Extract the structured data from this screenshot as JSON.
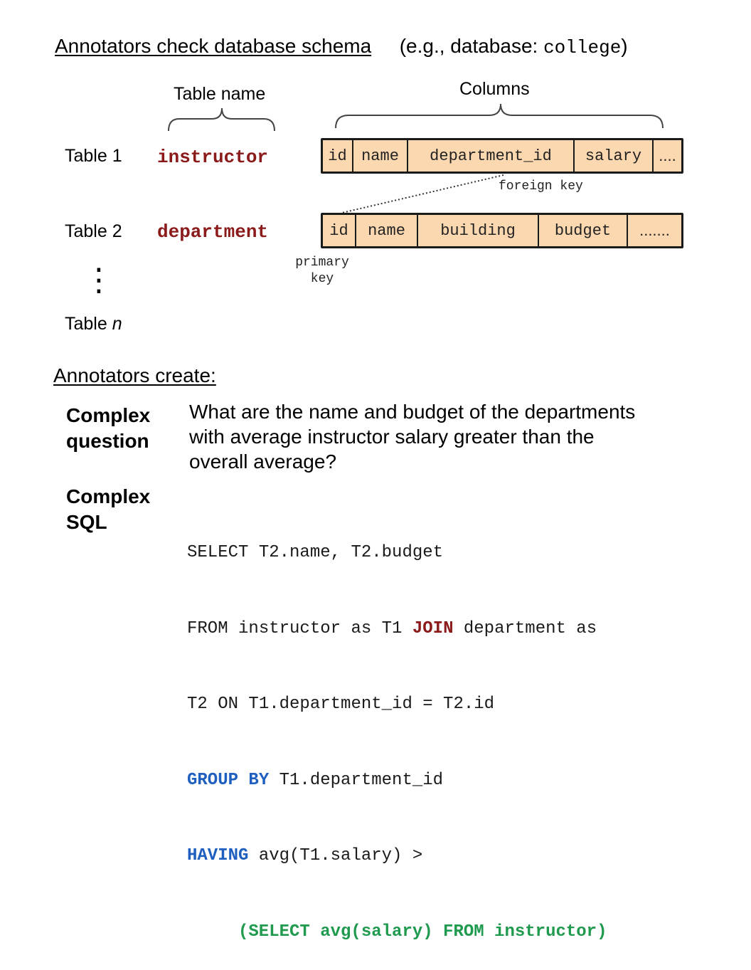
{
  "schema_heading": {
    "title": "Annotators check database schema",
    "example_prefix": "(e.g., database: ",
    "example_db": "college",
    "example_suffix": ")"
  },
  "braces": {
    "table_name_label": "Table name",
    "columns_label": "Columns"
  },
  "tables": [
    {
      "label": "Table 1",
      "name": "instructor",
      "columns": [
        "id",
        "name",
        "department_id",
        "salary",
        "...."
      ]
    },
    {
      "label": "Table 2",
      "name": "department",
      "columns": [
        "id",
        "name",
        "building",
        "budget",
        "......."
      ]
    }
  ],
  "foreign_key_label": "foreign key",
  "primary_key_label": [
    "primary",
    "key"
  ],
  "vertical_dots": "⋮",
  "table_n": {
    "prefix": "Table ",
    "var": "n"
  },
  "create_heading": "Annotators create:",
  "question": {
    "label_lines": [
      "Complex",
      "question"
    ],
    "text_lines": [
      "What are the name and budget of the departments",
      "with average instructor salary greater than the",
      "overall average?"
    ]
  },
  "sql": {
    "label_lines": [
      "Complex",
      "SQL"
    ],
    "line1": "SELECT T2.name, T2.budget",
    "line2_a": "FROM instructor as T1 ",
    "line2_kw": "JOIN",
    "line2_b": " department as",
    "line3": "T2 ON T1.department_id = T2.id",
    "line4_kw": "GROUP BY",
    "line4_b": " T1.department_id",
    "line5_kw": "HAVING",
    "line5_b": " avg(T1.salary) >",
    "line6": "(SELECT avg(salary) FROM instructor)"
  },
  "colors": {
    "table_name": "#8b1a1a",
    "column_fill": "#fbd8b0",
    "keyword_red": "#8b1a1a",
    "keyword_blue": "#1f5fbf",
    "keyword_green": "#1f9a4f"
  }
}
